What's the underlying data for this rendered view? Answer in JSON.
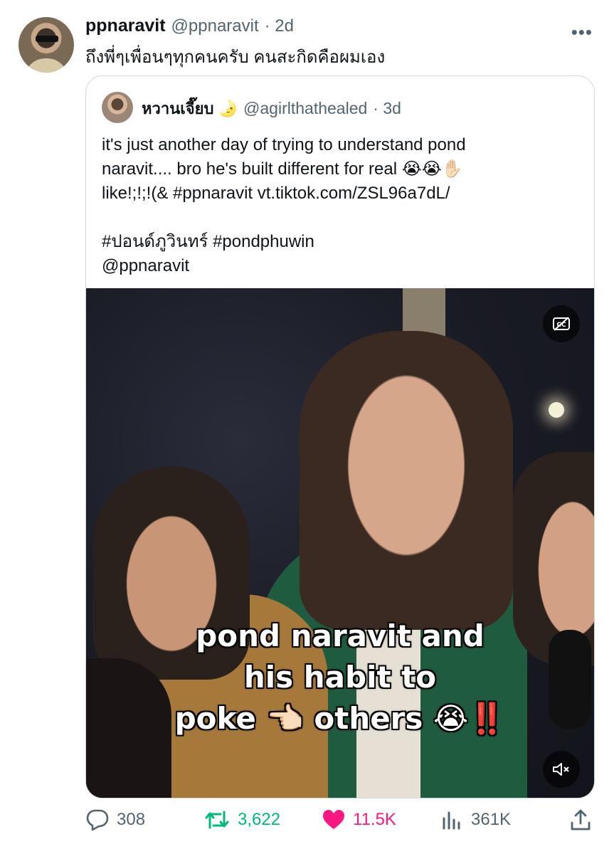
{
  "tweet": {
    "display_name": "ppnaravit",
    "handle": "@ppnaravit",
    "time": "· 2d",
    "more_icon": "more-icon",
    "text": "ถึงพี่ๆเพื่อนๆทุกคนครับ คนสะกิดคือผมเอง"
  },
  "quote": {
    "display_name": "หวานเจี๊ยบ 🌛",
    "handle": "@agirlthathealed",
    "time": "· 3d",
    "lines": [
      "it's just another day of trying to understand pond",
      "naravit.... bro he's built different for real 😭😭✋🏻",
      "like!;!;!(& #ppnaravit  vt.tiktok.com/ZSL96a7dL/",
      "",
      "#ปอนด์ภูวินทร์ #pondphuwin",
      "@ppnaravit"
    ],
    "video": {
      "caption_lines": [
        "pond naravit and",
        "his habit to",
        "poke 👈🏻 others 😭‼️"
      ],
      "cc_icon": "captions-off-icon",
      "mute_icon": "muted-speaker-icon"
    }
  },
  "actions": {
    "replies": "308",
    "retweets": "3,622",
    "likes": "11.5K",
    "views": "361K"
  },
  "colors": {
    "retweet": "#00ba7c",
    "like": "#f91880",
    "muted_text": "#536471",
    "border": "#cfd9de"
  }
}
